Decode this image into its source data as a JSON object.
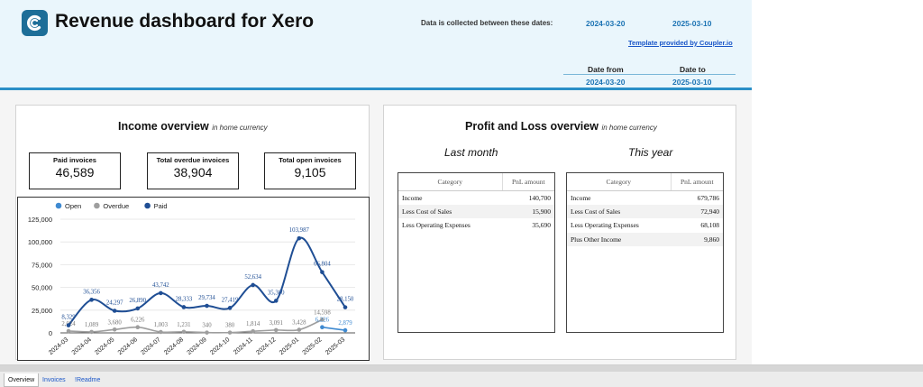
{
  "header": {
    "title": "Revenue dashboard for Xero",
    "collected_label": "Data is collected between these dates:",
    "start_date": "2024-03-20",
    "end_date": "2025-03-10",
    "template_link": "Template provided by Coupler.io",
    "date_from_label": "Date from",
    "date_to_label": "Date to",
    "date_from_value": "2024-03-20",
    "date_to_value": "2025-03-10",
    "logo_icon": "coupler-logo-icon"
  },
  "income": {
    "title": "Income overview",
    "subtitle": "in home currency",
    "kpis": [
      {
        "label": "Paid invoices",
        "value": "46,589"
      },
      {
        "label": "Total overdue invoices",
        "value": "38,904"
      },
      {
        "label": "Total open invoices",
        "value": "9,105"
      }
    ]
  },
  "chart_data": {
    "type": "line",
    "title": "",
    "xlabel": "",
    "ylabel": "",
    "ylim": [
      0,
      125000
    ],
    "yticks": [
      "0",
      "25,000",
      "50,000",
      "75,000",
      "100,000",
      "125,000"
    ],
    "legend_position": "top-left",
    "grid": true,
    "categories": [
      "2024-03",
      "2024-04",
      "2024-05",
      "2024-06",
      "2024-07",
      "2024-08",
      "2024-09",
      "2024-10",
      "2024-11",
      "2024-12",
      "2025-01",
      "2025-02",
      "2025-03"
    ],
    "series": [
      {
        "name": "Open",
        "color": "#3f8ad1",
        "values": [
          null,
          null,
          null,
          null,
          null,
          null,
          null,
          null,
          null,
          null,
          null,
          6226,
          2879
        ],
        "labels": [
          "",
          "",
          "",
          "",
          "",
          "",
          "",
          "",
          "",
          "",
          "",
          "6,226",
          "2,879"
        ]
      },
      {
        "name": "Overdue",
        "color": "#9e9e9e",
        "values": [
          2024,
          1089,
          3680,
          6226,
          1003,
          1231,
          340,
          380,
          1814,
          3091,
          3428,
          14598,
          null
        ],
        "labels": [
          "2,024",
          "1,089",
          "3,680",
          "6,226",
          "1,003",
          "1,231",
          "340",
          "380",
          "1,814",
          "3,091",
          "3,428",
          "14,598",
          ""
        ]
      },
      {
        "name": "Paid",
        "color": "#1f4e94",
        "values": [
          8329,
          36356,
          24297,
          26890,
          43742,
          28333,
          29734,
          27419,
          52634,
          35300,
          103987,
          66804,
          28150
        ],
        "labels": [
          "8,329",
          "36,356",
          "24,297",
          "26,890",
          "43,742",
          "28,333",
          "29,734",
          "27,419",
          "52,634",
          "35,300",
          "103,987",
          "66,804",
          "28,150"
        ]
      }
    ]
  },
  "pnl": {
    "title": "Profit and Loss overview",
    "subtitle": "in home currency",
    "last_month": {
      "heading": "Last month",
      "col_category": "Category",
      "col_amount": "PnL amount",
      "rows": [
        {
          "category": "Income",
          "amount": "140,700"
        },
        {
          "category": "Less Cost of Sales",
          "amount": "15,900"
        },
        {
          "category": "Less Operating Expenses",
          "amount": "35,690"
        }
      ]
    },
    "this_year": {
      "heading": "This year",
      "col_category": "Category",
      "col_amount": "PnL amount",
      "rows": [
        {
          "category": "Income",
          "amount": "679,786"
        },
        {
          "category": "Less Cost of Sales",
          "amount": "72,940"
        },
        {
          "category": "Less Operating Expenses",
          "amount": "68,108"
        },
        {
          "category": "Plus Other Income",
          "amount": "9,860"
        }
      ]
    }
  },
  "tabs": [
    {
      "label": "Overview",
      "active": true
    },
    {
      "label": "Invoices",
      "active": false
    },
    {
      "label": "!Readme",
      "active": false
    }
  ]
}
